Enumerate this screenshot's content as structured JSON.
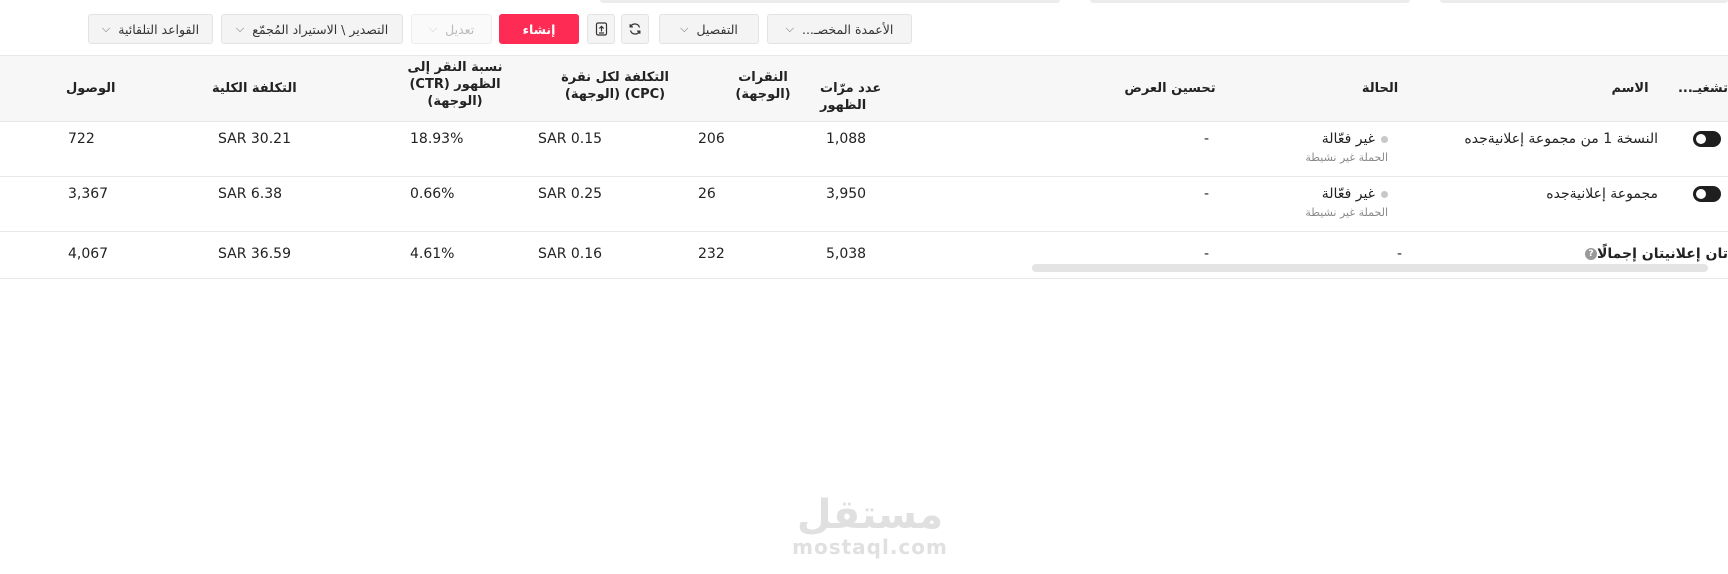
{
  "toolbar": {
    "auto_rules": "القواعد التلقائية",
    "export_import": "التصدير \\ الاستيراد المُجمّع",
    "edit": "تعديل",
    "create": "إنشاء",
    "breakdown": "التفصيل",
    "custom_columns": "الأعمدة المخصـ..."
  },
  "table": {
    "headers": {
      "toggle": "تشغيـ...",
      "name": "الاسم",
      "status": "الحالة",
      "delivery_opt": "تحسين العرض",
      "impressions": "عدد مرّات الظهور",
      "clicks": "النقرات\n(الوجهة)",
      "cpc": "التكلفة لكل نقرة\n(CPC) (الوجهة)",
      "ctr": "نسبة النقر إلى\nالظهور (CTR)\n(الوجهة)",
      "total_cost": "التكلفة الكلية",
      "reach": "الوصول"
    },
    "rows": [
      {
        "name": "النسخة 1 من مجموعة إعلانيةجده",
        "status": "غير فعّالة",
        "status_sub": "الحملة غير نشيطة",
        "delivery_opt": "-",
        "impressions": "1,088",
        "clicks": "206",
        "cpc": "SAR 0.15",
        "ctr": "18.93%",
        "total_cost": "SAR 30.21",
        "reach": "722"
      },
      {
        "name": "مجموعة إعلانيةجده",
        "status": "غير فعّالة",
        "status_sub": "الحملة غير نشيطة",
        "delivery_opt": "-",
        "impressions": "3,950",
        "clicks": "26",
        "cpc": "SAR 0.25",
        "ctr": "0.66%",
        "total_cost": "SAR 6.38",
        "reach": "3,367"
      }
    ],
    "total": {
      "name": "تان إعلانيتان إجمالًا",
      "status": "-",
      "delivery_opt": "-",
      "impressions": "5,038",
      "clicks": "232",
      "cpc": "SAR 0.16",
      "ctr": "4.61%",
      "total_cost": "SAR 36.59",
      "reach": "4,067"
    }
  },
  "watermark": {
    "arabic": "مستقل",
    "latin": "mostaql.com"
  },
  "colors": {
    "primary": "#fe2c55",
    "toggle": "#1f1f1f"
  }
}
